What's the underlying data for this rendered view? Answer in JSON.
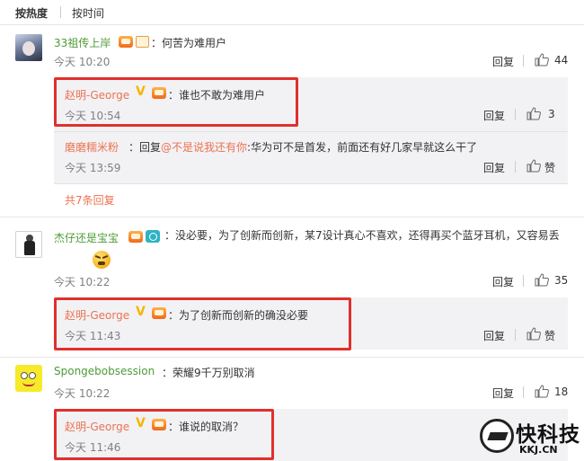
{
  "sort": {
    "hot": "按热度",
    "time": "按时间"
  },
  "comments": [
    {
      "user": "33祖传上岸",
      "text": "：何苦为难用户",
      "time": "今天 10:20",
      "reply": "回复",
      "likes": "44",
      "replies": [
        {
          "user": "赵明-George",
          "text": "：谁也不敢为难用户",
          "time": "今天 10:54",
          "reply": "回复",
          "likes": "3"
        },
        {
          "user": "磨磨糯米粉",
          "text_prefix": "：回复",
          "mention": "@不是说我还有你",
          "text_suffix": ":华为可不是首发，前面还有好几家早就这么干了",
          "time": "今天 13:59",
          "reply": "回复",
          "zan": "赞"
        }
      ],
      "more": "共7条回复"
    },
    {
      "user": "杰仔还是宝宝",
      "text": "：没必要，为了创新而创新，某7设计真心不喜欢，还得再买个蓝牙耳机，又容易丢",
      "time": "今天 10:22",
      "reply": "回复",
      "likes": "35",
      "replies": [
        {
          "user": "赵明-George",
          "text": "：为了创新而创新的确没必要",
          "time": "今天 11:43",
          "reply": "回复",
          "zan": "赞"
        }
      ]
    },
    {
      "user": "Spongebobsession",
      "text": "：荣耀9千万别取消",
      "time": "今天 10:22",
      "reply": "回复",
      "likes": "18",
      "replies": [
        {
          "user": "赵明-George",
          "text": "：谁说的取消？",
          "time": "今天 11:46"
        }
      ]
    }
  ],
  "watermark": {
    "name": "快科技",
    "url": "KKJ.CN"
  },
  "colors": {
    "accent": "#eb7350",
    "highlight": "#e0302c",
    "green_name": "#4d9b37"
  }
}
